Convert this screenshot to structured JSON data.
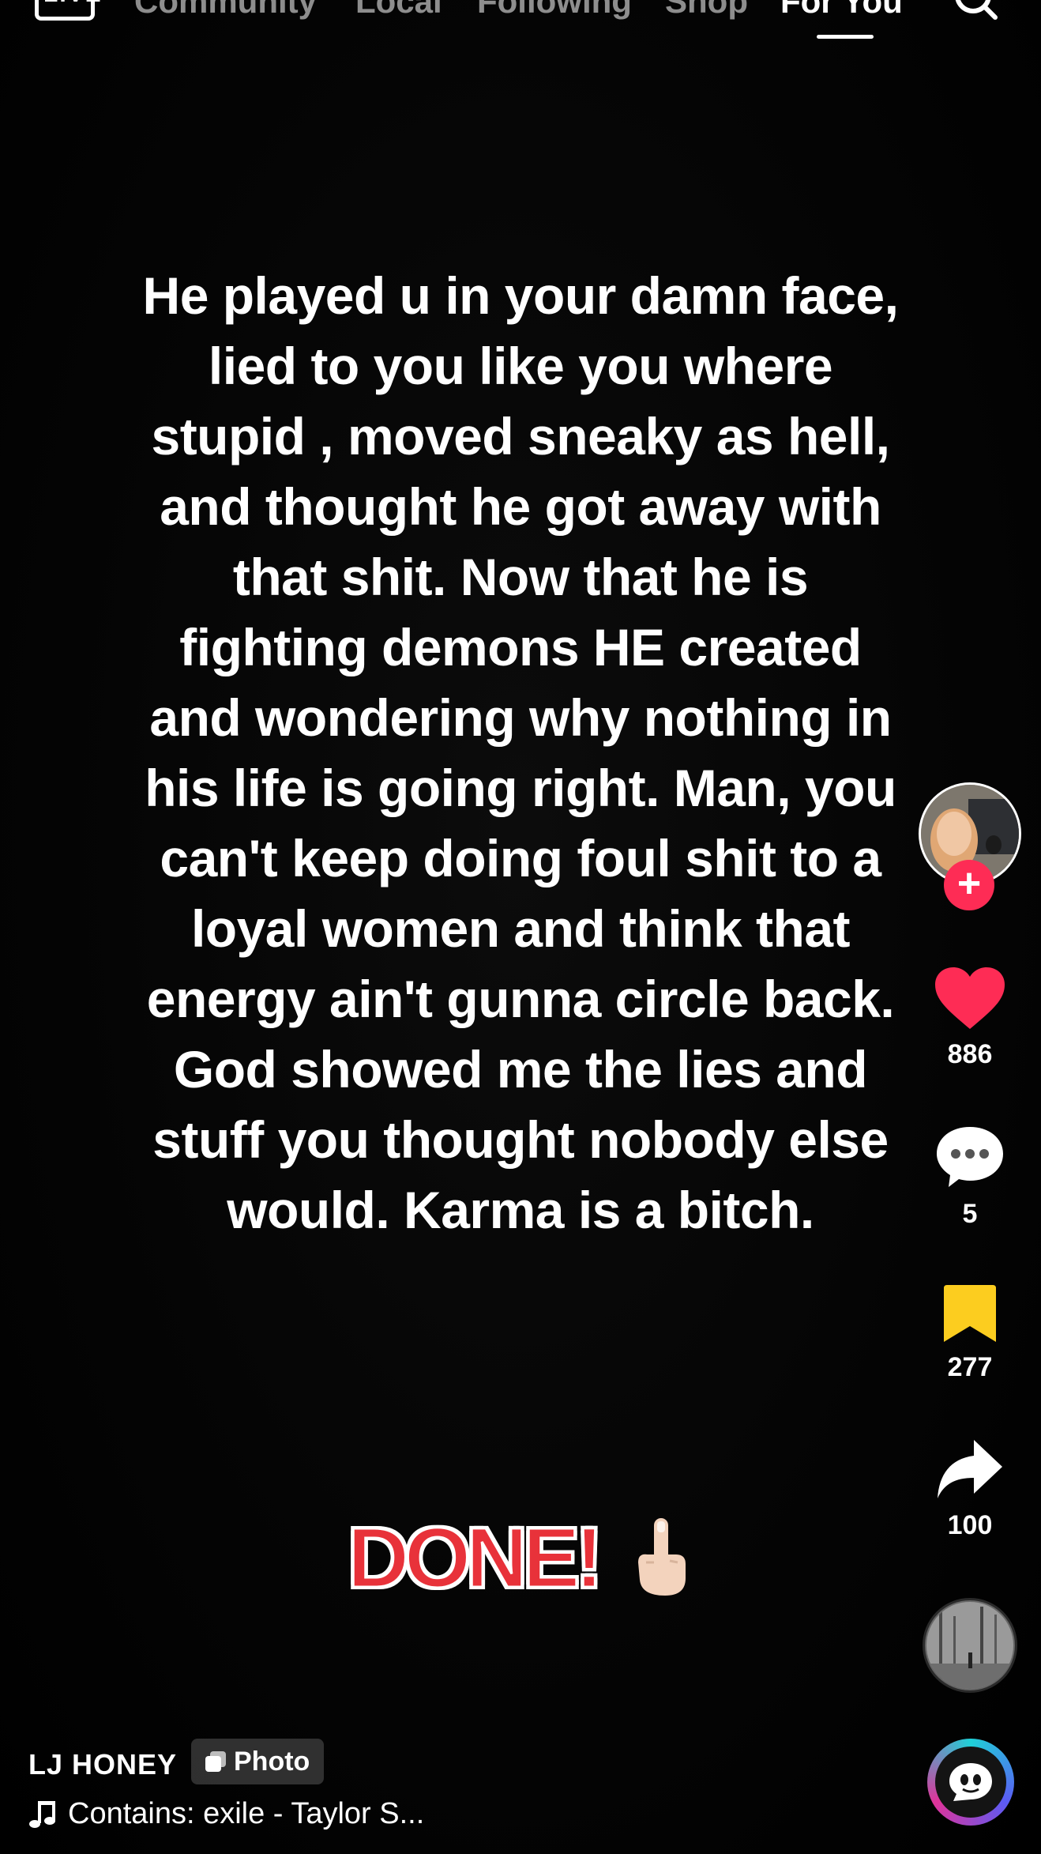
{
  "nav": {
    "live_label": "LIVE",
    "tabs": [
      {
        "label": "Community"
      },
      {
        "label": "Local"
      },
      {
        "label": "Following"
      },
      {
        "label": "Shop"
      },
      {
        "label": "For You"
      }
    ],
    "active_tab": "For You"
  },
  "post": {
    "caption": "He played u in your damn face, lied to you like you where stupid , moved sneaky as hell, and thought he got away with that shit. Now that he is fighting demons HE created and wondering why nothing in his life is going right. Man, you can't keep doing foul shit to a loyal women and think that energy ain't gunna circle back.  God showed me  the lies and stuff you thought nobody else would. Karma is a bitch.",
    "done_text": "DONE!",
    "emoji": "middle-finger-icon"
  },
  "actions": {
    "likes": "886",
    "comments": "5",
    "saves": "277",
    "shares": "100",
    "follow_symbol": "+"
  },
  "author": {
    "username": "LJ HONEY",
    "badge_label": "Photo"
  },
  "music": {
    "text": "Contains: exile - Taylor S..."
  },
  "colors": {
    "like": "#fe2c55",
    "bookmark": "#fccd1f",
    "done": "#e8323a"
  }
}
